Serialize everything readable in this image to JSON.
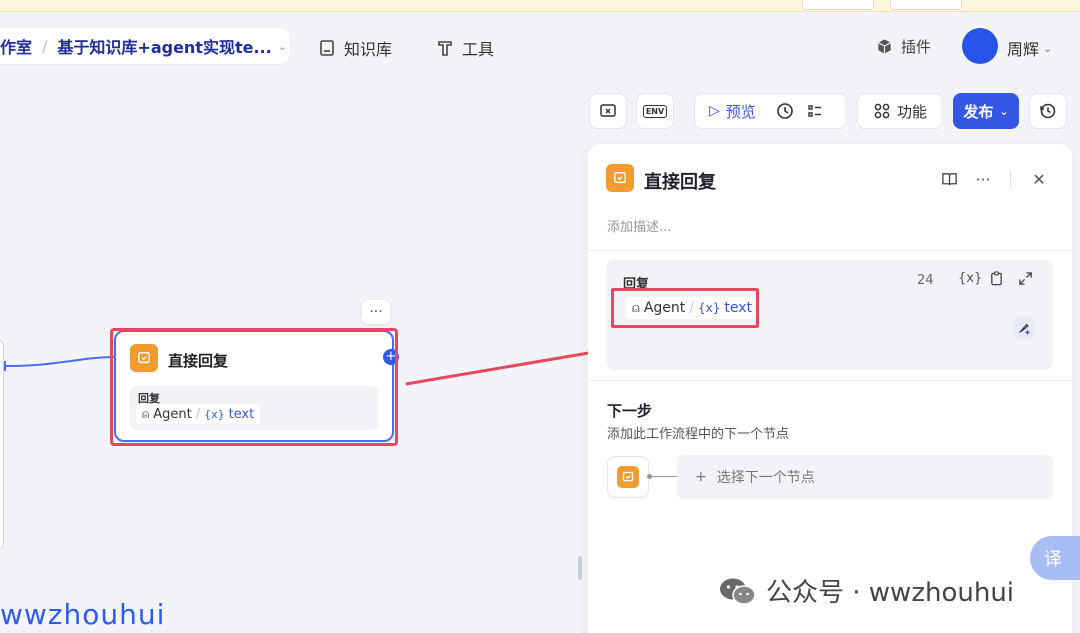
{
  "header": {
    "breadcrumb": {
      "space": "作室",
      "project": "基于知识库+agent实现te..."
    },
    "nav": {
      "knowledge": "知识库",
      "tools": "工具"
    },
    "plugin": "插件",
    "user": "周辉"
  },
  "toolbar": {
    "preview": "预览",
    "features": "功能",
    "publish": "发布",
    "env_icon_text": "ENV"
  },
  "node": {
    "title": "直接回复",
    "field_label": "回复",
    "source": "Agent",
    "var_token": "{x}",
    "var_name": "text",
    "port": "+",
    "more": "···"
  },
  "panel": {
    "title": "直接回复",
    "description_placeholder": "添加描述...",
    "reply": {
      "label": "回复",
      "count": "24",
      "var_tool": "{x}",
      "source": "Agent",
      "var_token": "{x}",
      "var_name": "text"
    },
    "next": {
      "title": "下一步",
      "description": "添加此工作流程中的下一个节点",
      "plus": "+",
      "select_label": "选择下一个节点"
    }
  },
  "translate": "译",
  "watermark": "公众号 · wwzhouhui",
  "corner_watermark": "wwzhouhui",
  "colors": {
    "accent": "#3557e6",
    "node_icon": "#f29b2e",
    "highlight": "#e8475f"
  }
}
